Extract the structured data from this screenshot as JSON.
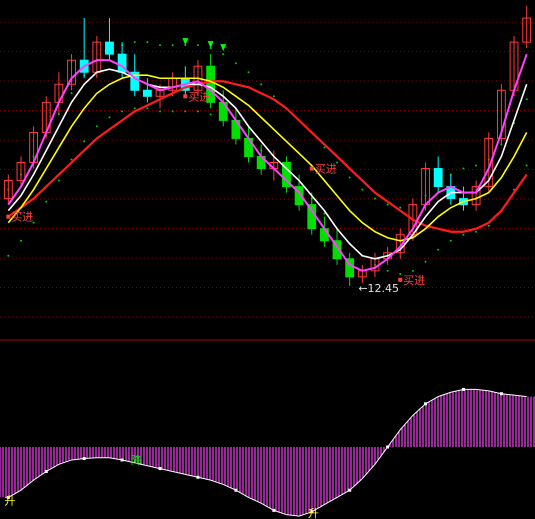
{
  "chart_data": [
    {
      "type": "candlestick",
      "panel": "price",
      "ylim": [
        11.8,
        17.2
      ],
      "colors": {
        "up_candle": "#ff3b3b",
        "down_candle": "#00ffff",
        "down_candle_alt": "#00e000",
        "ma_fast": "#ff40ff",
        "ma_mid": "#ffffff",
        "ma_slow": "#ffff00",
        "ma_long": "#ff1c1c",
        "envelope_dots": "#00cc00",
        "grid": "#8b0000"
      },
      "candles": [
        {
          "o": 13.9,
          "h": 14.3,
          "l": 13.8,
          "c": 14.2
        },
        {
          "o": 14.2,
          "h": 14.6,
          "l": 14.1,
          "c": 14.5
        },
        {
          "o": 14.5,
          "h": 15.1,
          "l": 14.4,
          "c": 15.0
        },
        {
          "o": 15.0,
          "h": 15.6,
          "l": 14.9,
          "c": 15.5
        },
        {
          "o": 15.5,
          "h": 16.0,
          "l": 15.3,
          "c": 15.8
        },
        {
          "o": 15.8,
          "h": 16.3,
          "l": 15.7,
          "c": 16.2
        },
        {
          "o": 16.2,
          "h": 16.9,
          "l": 15.9,
          "c": 16.0
        },
        {
          "o": 16.0,
          "h": 16.6,
          "l": 15.9,
          "c": 16.5
        },
        {
          "o": 16.5,
          "h": 16.9,
          "l": 16.2,
          "c": 16.3
        },
        {
          "o": 16.3,
          "h": 16.5,
          "l": 15.9,
          "c": 16.0
        },
        {
          "o": 16.0,
          "h": 16.3,
          "l": 15.6,
          "c": 15.7
        },
        {
          "o": 15.7,
          "h": 15.9,
          "l": 15.5,
          "c": 15.6
        },
        {
          "o": 15.6,
          "h": 15.8,
          "l": 15.4,
          "c": 15.7
        },
        {
          "o": 15.7,
          "h": 16.0,
          "l": 15.6,
          "c": 15.9
        },
        {
          "o": 15.9,
          "h": 16.1,
          "l": 15.6,
          "c": 15.7
        },
        {
          "o": 15.7,
          "h": 16.2,
          "l": 15.6,
          "c": 16.1
        },
        {
          "o": 16.1,
          "h": 16.3,
          "l": 15.4,
          "c": 15.5
        },
        {
          "o": 15.5,
          "h": 15.7,
          "l": 15.1,
          "c": 15.2
        },
        {
          "o": 15.2,
          "h": 15.4,
          "l": 14.8,
          "c": 14.9
        },
        {
          "o": 14.9,
          "h": 15.1,
          "l": 14.5,
          "c": 14.6
        },
        {
          "o": 14.6,
          "h": 14.8,
          "l": 14.3,
          "c": 14.4
        },
        {
          "o": 14.4,
          "h": 14.7,
          "l": 14.2,
          "c": 14.5
        },
        {
          "o": 14.5,
          "h": 14.6,
          "l": 14.0,
          "c": 14.1
        },
        {
          "o": 14.1,
          "h": 14.3,
          "l": 13.7,
          "c": 13.8
        },
        {
          "o": 13.8,
          "h": 14.0,
          "l": 13.3,
          "c": 13.4
        },
        {
          "o": 13.4,
          "h": 13.6,
          "l": 13.1,
          "c": 13.2
        },
        {
          "o": 13.2,
          "h": 13.4,
          "l": 12.8,
          "c": 12.9
        },
        {
          "o": 12.9,
          "h": 13.0,
          "l": 12.45,
          "c": 12.6
        },
        {
          "o": 12.6,
          "h": 12.8,
          "l": 12.5,
          "c": 12.7
        },
        {
          "o": 12.7,
          "h": 13.0,
          "l": 12.6,
          "c": 12.9
        },
        {
          "o": 12.9,
          "h": 13.1,
          "l": 12.8,
          "c": 13.0
        },
        {
          "o": 13.0,
          "h": 13.4,
          "l": 12.9,
          "c": 13.3
        },
        {
          "o": 13.3,
          "h": 13.9,
          "l": 13.2,
          "c": 13.8
        },
        {
          "o": 13.8,
          "h": 14.5,
          "l": 13.7,
          "c": 14.4
        },
        {
          "o": 14.4,
          "h": 14.6,
          "l": 14.0,
          "c": 14.1
        },
        {
          "o": 14.1,
          "h": 14.3,
          "l": 13.8,
          "c": 13.9
        },
        {
          "o": 13.9,
          "h": 14.1,
          "l": 13.7,
          "c": 13.8
        },
        {
          "o": 13.8,
          "h": 14.2,
          "l": 13.7,
          "c": 14.1
        },
        {
          "o": 14.1,
          "h": 15.0,
          "l": 14.0,
          "c": 14.9
        },
        {
          "o": 14.9,
          "h": 15.8,
          "l": 14.8,
          "c": 15.7
        },
        {
          "o": 15.7,
          "h": 16.6,
          "l": 15.6,
          "c": 16.5
        },
        {
          "o": 16.5,
          "h": 17.1,
          "l": 16.4,
          "c": 16.9
        }
      ],
      "moving_averages": {
        "ma_fast": [
          13.8,
          14.1,
          14.5,
          15.0,
          15.5,
          15.9,
          16.1,
          16.2,
          16.2,
          16.1,
          15.9,
          15.8,
          15.7,
          15.75,
          15.8,
          15.85,
          15.7,
          15.5,
          15.2,
          14.9,
          14.6,
          14.4,
          14.2,
          14.0,
          13.7,
          13.4,
          13.1,
          12.8,
          12.7,
          12.75,
          12.9,
          13.1,
          13.4,
          13.8,
          14.0,
          14.1,
          14.0,
          14.0,
          14.4,
          15.0,
          15.7,
          16.3
        ],
        "ma_mid": [
          13.7,
          13.95,
          14.3,
          14.7,
          15.1,
          15.5,
          15.8,
          16.0,
          16.05,
          16.0,
          15.9,
          15.8,
          15.75,
          15.75,
          15.8,
          15.8,
          15.75,
          15.6,
          15.4,
          15.1,
          14.85,
          14.6,
          14.4,
          14.2,
          13.95,
          13.7,
          13.4,
          13.15,
          12.95,
          12.9,
          12.95,
          13.05,
          13.3,
          13.6,
          13.85,
          14.0,
          14.0,
          14.0,
          14.2,
          14.6,
          15.2,
          15.8
        ],
        "ma_slow": [
          13.5,
          13.75,
          14.05,
          14.4,
          14.75,
          15.1,
          15.4,
          15.65,
          15.8,
          15.9,
          15.95,
          15.95,
          15.9,
          15.9,
          15.9,
          15.9,
          15.85,
          15.75,
          15.6,
          15.45,
          15.25,
          15.05,
          14.85,
          14.65,
          14.45,
          14.2,
          13.95,
          13.7,
          13.5,
          13.35,
          13.25,
          13.2,
          13.25,
          13.4,
          13.6,
          13.75,
          13.85,
          13.9,
          14.0,
          14.25,
          14.6,
          15.0
        ],
        "ma_long": [
          13.6,
          13.75,
          13.9,
          14.1,
          14.3,
          14.5,
          14.7,
          14.9,
          15.05,
          15.2,
          15.35,
          15.45,
          15.55,
          15.65,
          15.75,
          15.8,
          15.85,
          15.85,
          15.8,
          15.75,
          15.65,
          15.55,
          15.4,
          15.2,
          15.0,
          14.8,
          14.6,
          14.4,
          14.2,
          14.0,
          13.85,
          13.7,
          13.55,
          13.45,
          13.4,
          13.35,
          13.35,
          13.4,
          13.5,
          13.7,
          14.0,
          14.3
        ]
      },
      "markers": [
        {
          "text": "买进",
          "index": 0,
          "price": 13.6,
          "color": "#ff4040"
        },
        {
          "text": "买进",
          "index": 14,
          "price": 15.6,
          "color": "#ff4040"
        },
        {
          "text": "买进",
          "index": 24,
          "price": 14.4,
          "color": "#ff4040"
        },
        {
          "text": "买进",
          "index": 31,
          "price": 12.55,
          "color": "#ff4040"
        },
        {
          "text": "↓",
          "index": 14,
          "price": 16.5,
          "color": "#00ff00"
        },
        {
          "text": "↓",
          "index": 16,
          "price": 16.45,
          "color": "#00ff00"
        },
        {
          "text": "↓",
          "index": 17,
          "price": 16.4,
          "color": "#00ff00"
        }
      ],
      "low_annotation": {
        "text": "←12.45",
        "index": 28,
        "price": 12.45
      }
    },
    {
      "type": "area",
      "panel": "oscillator",
      "ylim": [
        0,
        100
      ],
      "colors": {
        "fill": "#ff40ff",
        "line": "#ffffff",
        "label_rise": "#ffff00",
        "label_fall": "#00ff00"
      },
      "values": [
        15,
        20,
        27,
        33,
        38,
        41,
        42,
        42.5,
        42.5,
        41,
        39,
        37,
        35,
        33,
        31,
        29,
        27,
        24,
        20,
        15,
        11,
        6,
        3,
        2,
        5,
        10,
        15,
        20,
        28,
        38,
        50,
        62,
        72,
        80,
        85,
        88,
        90,
        90,
        89,
        87,
        86,
        85
      ],
      "labels": [
        {
          "text": "升",
          "index": 0,
          "value": 13,
          "color": "#ffff00"
        },
        {
          "text": "降",
          "index": 10,
          "value": 41,
          "color": "#00ff00"
        },
        {
          "text": "升",
          "index": 24,
          "value": 4,
          "color": "#ffff00"
        }
      ]
    }
  ]
}
